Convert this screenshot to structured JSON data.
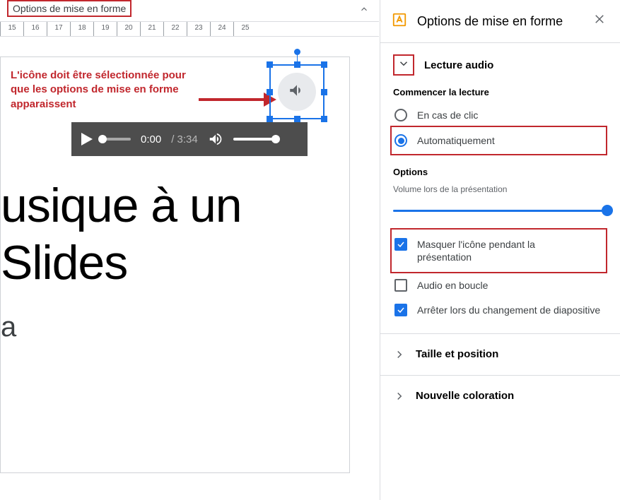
{
  "topbar": {
    "title": "Options de mise en forme"
  },
  "ruler": {
    "start": 15,
    "end": 25
  },
  "annotation": {
    "text": "L'icône doit être sélectionnée pour que les options de mise en forme apparaissent"
  },
  "player": {
    "current": "0:00",
    "duration": "3:34"
  },
  "slide_text": {
    "line1": "usique à un",
    "line2": "Slides",
    "line3": "a"
  },
  "panel": {
    "title": "Options de mise en forme",
    "section_audio": {
      "title": "Lecture audio",
      "start_label": "Commencer la lecture",
      "radio_click": "En cas de clic",
      "radio_auto": "Automatiquement",
      "options_head": "Options",
      "volume_label": "Volume lors de la présentation"
    },
    "checkboxes": {
      "hide_icon": "Masquer l'icône pendant la présentation",
      "loop": "Audio en boucle",
      "stop_on_change": "Arrêter lors du changement de diapositive"
    },
    "section_size": "Taille et position",
    "section_recolor": "Nouvelle coloration"
  }
}
